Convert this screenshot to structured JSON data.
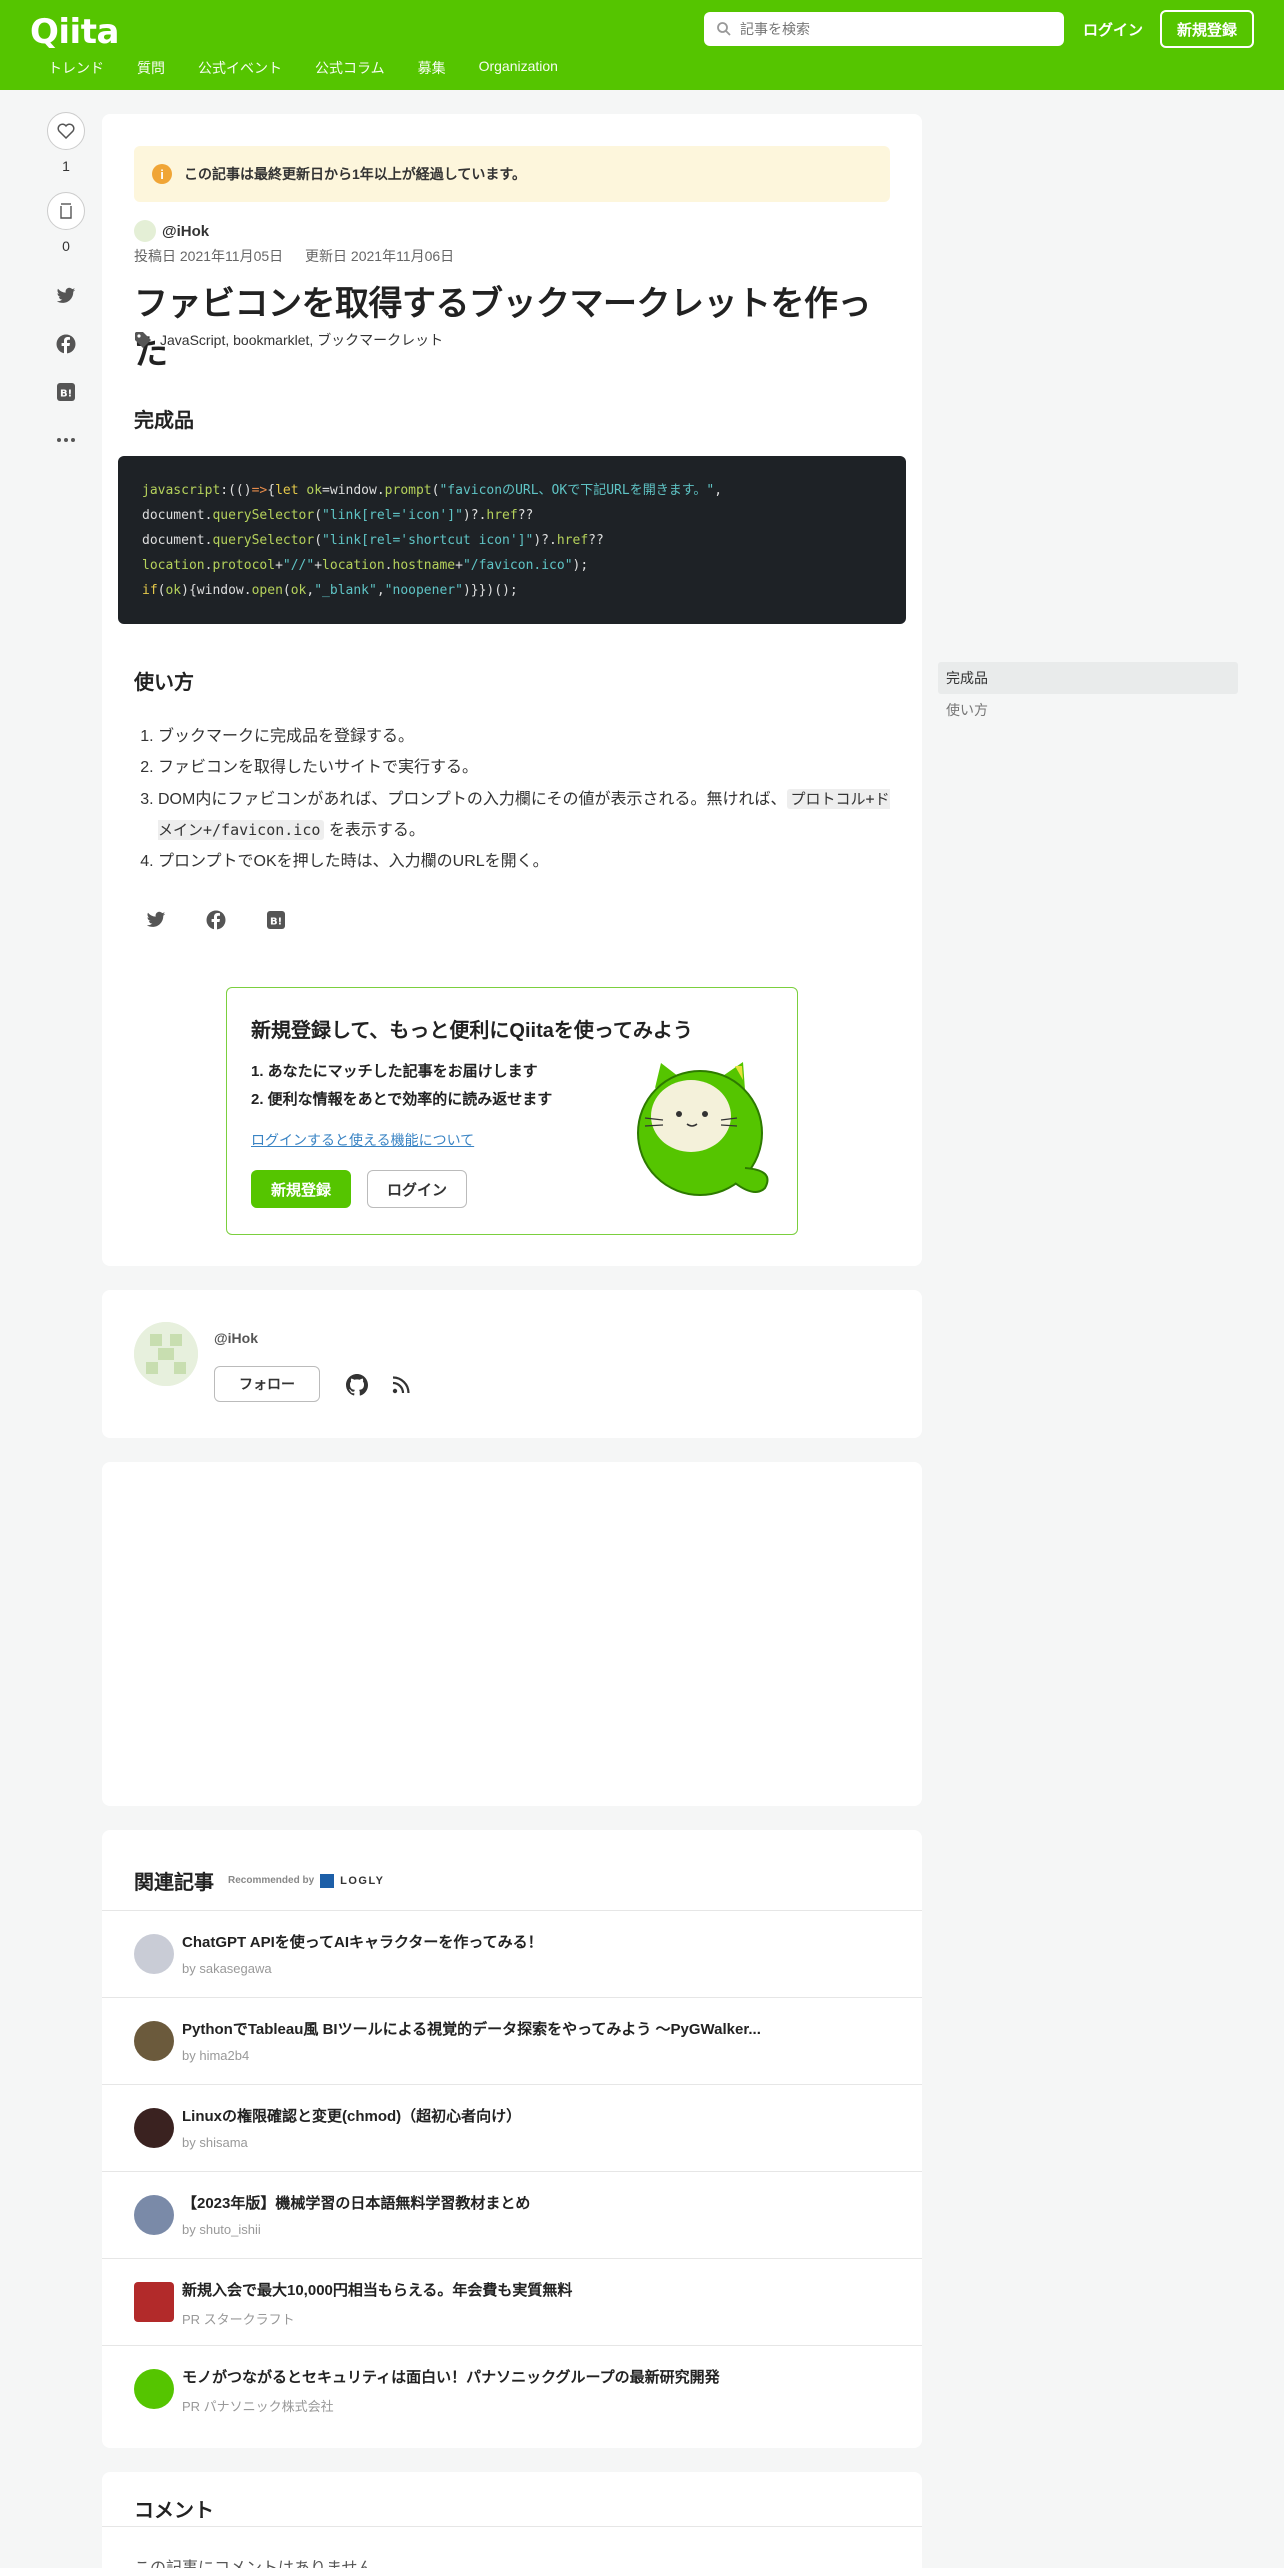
{
  "header": {
    "logo": "Qiita",
    "search_placeholder": "記事を検索",
    "login": "ログイン",
    "signup": "新規登録",
    "nav": [
      "トレンド",
      "質問",
      "公式イベント",
      "公式コラム",
      "募集",
      "Organization"
    ]
  },
  "actions": {
    "like_count": "1",
    "stock_count": "0"
  },
  "article": {
    "notice": "この記事は最終更新日から1年以上が経過しています。",
    "author": "@iHok",
    "posted": "投稿日 2021年11月05日",
    "updated": "更新日 2021年11月06日",
    "title": "ファビコンを取得するブックマークレットを作った",
    "tags": [
      "JavaScript",
      "bookmarklet",
      "ブックマークレット"
    ],
    "h2_1": "完成品",
    "code_lines": [
      "javascript:(()=>{let ok=window.prompt(\"faviconのURL、OKで下記URLを開きます。\",",
      "document.querySelector(\"link[rel='icon']\")?.href??",
      "document.querySelector(\"link[rel='shortcut icon']\")?.href??",
      "location.protocol+\"//\"+location.hostname+\"/favicon.ico\");",
      "if(ok){window.open(ok,\"_blank\",\"noopener\")}})();"
    ],
    "h2_2": "使い方",
    "steps": [
      "ブックマークに完成品を登録する。",
      "ファビコンを取得したいサイトで実行する。",
      "DOM内にファビコンがあれば、プロンプトの入力欄にその値が表示される。無ければ、",
      "プロンプトでOKを押した時は、入力欄のURLを開く。"
    ],
    "step3_code": "プロトコル+ドメイン+/favicon.ico",
    "step3_tail": "を表示する。"
  },
  "promo": {
    "title": "新規登録して、もっと便利にQiitaを使ってみよう",
    "points": [
      "1. あなたにマッチした記事をお届けします",
      "2. 便利な情報をあとで効率的に読み返せます"
    ],
    "link": "ログインすると使える機能について",
    "signup": "新規登録",
    "login": "ログイン"
  },
  "profile": {
    "name": "@iHok",
    "follow": "フォロー"
  },
  "related": {
    "title": "関連記事",
    "recommended": "Recommended by",
    "logly": "LOGLY",
    "items": [
      {
        "title": "ChatGPT APIを使ってAIキャラクターを作ってみる！",
        "by": "by sakasegawa",
        "color": "#c9ccd6"
      },
      {
        "title": "PythonでTableau風 BIツールによる視覚的データ探索をやってみよう 〜PyGWalker...",
        "by": "by hima2b4",
        "color": "#6b5a3c"
      },
      {
        "title": "Linuxの権限確認と変更(chmod)（超初心者向け）",
        "by": "by shisama",
        "color": "#3a2220"
      },
      {
        "title": "【2023年版】機械学習の日本語無料学習教材まとめ",
        "by": "by shuto_ishii",
        "color": "#7a8aa8"
      },
      {
        "title": "新規入会で最大10,000円相当もらえる。年会費も実質無料",
        "by": "PR スタークラフト",
        "color": "#b22a2a"
      },
      {
        "title": "モノがつながるとセキュリティは面白い！パナソニックグループの最新研究開発",
        "by": "PR パナソニック株式会社",
        "color": "#55c500"
      }
    ]
  },
  "comments": {
    "title": "コメント",
    "empty": "この記事にコメントはありません。"
  },
  "toc": [
    "完成品",
    "使い方"
  ]
}
